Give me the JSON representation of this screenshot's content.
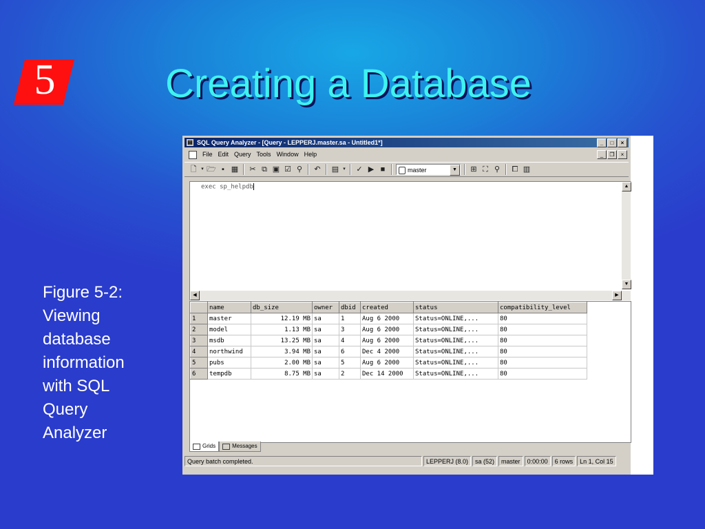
{
  "slide": {
    "number": "5",
    "title": "Creating a Database",
    "caption_lines": [
      "Figure 5-2:",
      "Viewing",
      "database",
      "information",
      "with SQL",
      "Query",
      "Analyzer"
    ]
  },
  "app": {
    "title": "SQL Query Analyzer - [Query - LEPPERJ.master.sa - Untitled1*]",
    "menu": [
      "File",
      "Edit",
      "Query",
      "Tools",
      "Window",
      "Help"
    ],
    "database": "master",
    "query_text": "exec sp_helpdb"
  },
  "grid": {
    "columns": [
      "name",
      "db_size",
      "owner",
      "dbid",
      "created",
      "status",
      "compatibility_level"
    ],
    "rows": [
      [
        "1",
        "master",
        "12.19 MB",
        "sa",
        "1",
        "Aug  6 2000",
        "Status=ONLINE,...",
        "80"
      ],
      [
        "2",
        "model",
        "1.13 MB",
        "sa",
        "3",
        "Aug  6 2000",
        "Status=ONLINE,...",
        "80"
      ],
      [
        "3",
        "msdb",
        "13.25 MB",
        "sa",
        "4",
        "Aug  6 2000",
        "Status=ONLINE,...",
        "80"
      ],
      [
        "4",
        "northwind",
        "3.94 MB",
        "sa",
        "6",
        "Dec  4 2000",
        "Status=ONLINE,...",
        "80"
      ],
      [
        "5",
        "pubs",
        "2.00 MB",
        "sa",
        "5",
        "Aug  6 2000",
        "Status=ONLINE,...",
        "80"
      ],
      [
        "6",
        "tempdb",
        "8.75 MB",
        "sa",
        "2",
        "Dec 14 2000",
        "Status=ONLINE,...",
        "80"
      ]
    ]
  },
  "tabs": [
    "Grids",
    "Messages"
  ],
  "status": {
    "message": "Query batch completed.",
    "server": "LEPPERJ (8.0)",
    "user": "sa (52)",
    "db": "master",
    "time": "0:00:00",
    "rows": "6 rows",
    "position": "Ln 1, Col 15"
  },
  "colors": {
    "title": "#3ff2ef",
    "badge": "#ff1010",
    "caption": "#ffffff"
  }
}
